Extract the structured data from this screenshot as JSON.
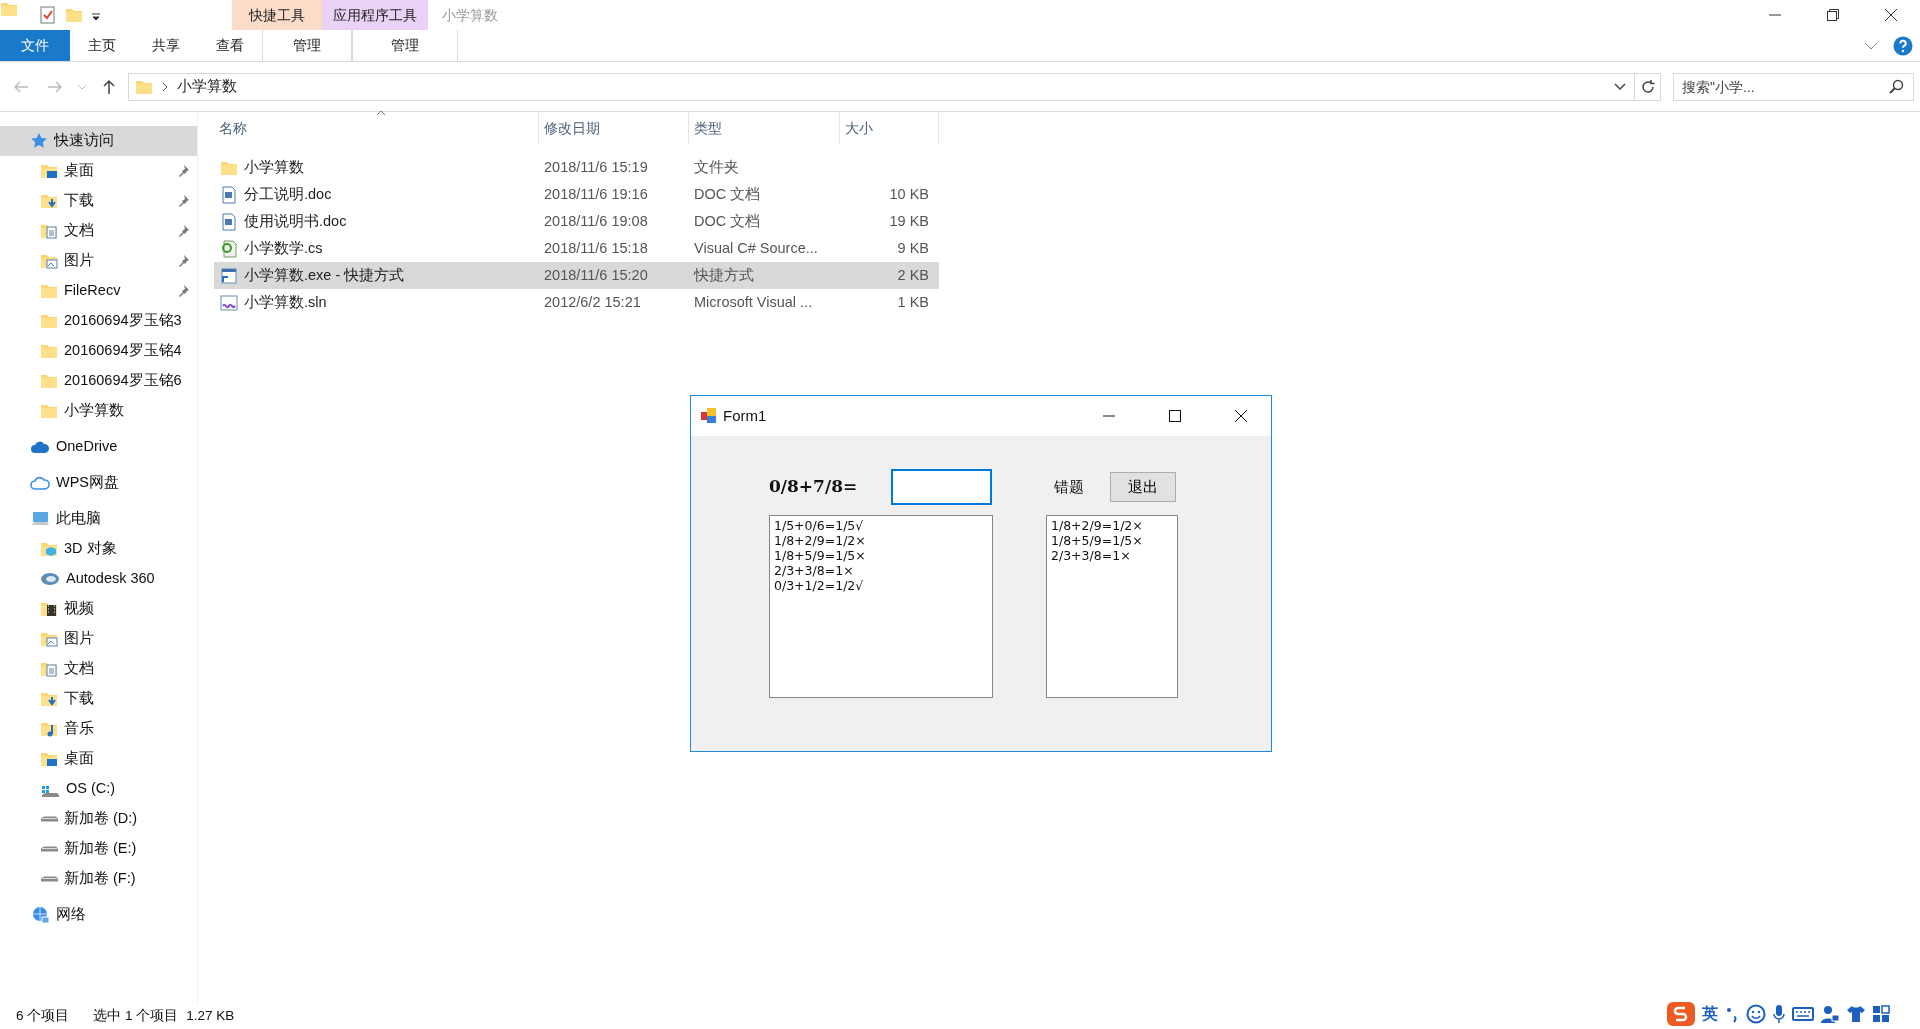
{
  "title_bar": {
    "title": "小学算数",
    "context_groups": [
      {
        "label": "快捷工具",
        "color": "#fcdcc8"
      },
      {
        "label": "应用程序工具",
        "color": "#ead2f6"
      }
    ]
  },
  "ribbon_tabs": [
    {
      "label": "文件",
      "kind": "file"
    },
    {
      "label": "主页",
      "kind": "tab"
    },
    {
      "label": "共享",
      "kind": "tab"
    },
    {
      "label": "查看",
      "kind": "tab"
    },
    {
      "label": "管理",
      "kind": "context"
    },
    {
      "label": "管理",
      "kind": "context"
    }
  ],
  "address_bar": {
    "path": "小学算数",
    "search_placeholder": "搜索\"小学..."
  },
  "sidebar": [
    {
      "label": "快速访问",
      "kind": "star",
      "selected": true,
      "children": [
        {
          "label": "桌面",
          "kind": "desktop",
          "pinned": true,
          "selected": false
        },
        {
          "label": "下载",
          "kind": "download",
          "pinned": true,
          "selected": false
        },
        {
          "label": "文档",
          "kind": "doc",
          "pinned": true,
          "selected": false
        },
        {
          "label": "图片",
          "kind": "pictures",
          "pinned": true,
          "selected": false
        },
        {
          "label": "FileRecv",
          "kind": "folder",
          "pinned": true,
          "selected": false
        },
        {
          "label": "20160694罗玉铭3",
          "kind": "folder",
          "pinned": false,
          "selected": false
        },
        {
          "label": "20160694罗玉铭4",
          "kind": "folder",
          "pinned": false,
          "selected": false
        },
        {
          "label": "20160694罗玉铭6",
          "kind": "folder",
          "pinned": false,
          "selected": false
        },
        {
          "label": "小学算数",
          "kind": "folder",
          "pinned": false,
          "selected": false
        }
      ]
    },
    {
      "label": "OneDrive",
      "kind": "cloud",
      "selected": false
    },
    {
      "label": "WPS网盘",
      "kind": "cloud-outline",
      "selected": false
    },
    {
      "label": "此电脑",
      "kind": "computer",
      "selected": false,
      "children": [
        {
          "label": "3D 对象",
          "kind": "cube",
          "pinned": false,
          "selected": false
        },
        {
          "label": "Autodesk 360",
          "kind": "autodesk",
          "pinned": false,
          "selected": false
        },
        {
          "label": "视频",
          "kind": "video",
          "pinned": false,
          "selected": false
        },
        {
          "label": "图片",
          "kind": "pictures",
          "pinned": false,
          "selected": false
        },
        {
          "label": "文档",
          "kind": "doc",
          "pinned": false,
          "selected": false
        },
        {
          "label": "下载",
          "kind": "download",
          "pinned": false,
          "selected": false
        },
        {
          "label": "音乐",
          "kind": "music",
          "pinned": false,
          "selected": false
        },
        {
          "label": "桌面",
          "kind": "desktop",
          "pinned": false,
          "selected": false
        },
        {
          "label": "OS (C:)",
          "kind": "os-drive",
          "pinned": false,
          "selected": false
        },
        {
          "label": "新加卷 (D:)",
          "kind": "drive",
          "pinned": false,
          "selected": false
        },
        {
          "label": "新加卷 (E:)",
          "kind": "drive",
          "pinned": false,
          "selected": false
        },
        {
          "label": "新加卷 (F:)",
          "kind": "drive",
          "pinned": false,
          "selected": false
        }
      ]
    },
    {
      "label": "网络",
      "kind": "network",
      "selected": false
    }
  ],
  "table": {
    "columns": [
      {
        "label": "名称",
        "sorted": true
      },
      {
        "label": "修改日期",
        "sorted": false
      },
      {
        "label": "类型",
        "sorted": false
      },
      {
        "label": "大小",
        "sorted": false
      }
    ],
    "rows": [
      {
        "kind": "folder",
        "name": "小学算数",
        "date": "2018/11/6 15:19",
        "type": "文件夹",
        "selected": false
      },
      {
        "kind": "word",
        "name": "分工说明.doc",
        "date": "2018/11/6 19:16",
        "type": "DOC 文档",
        "size": "10 KB",
        "selected": false
      },
      {
        "kind": "word",
        "name": "使用说明书.doc",
        "date": "2018/11/6 19:08",
        "type": "DOC 文档",
        "size": "19 KB",
        "selected": false
      },
      {
        "kind": "csharp",
        "name": "小学数学.cs",
        "date": "2018/11/6 15:18",
        "type": "Visual C# Source...",
        "size": "9 KB",
        "selected": false
      },
      {
        "kind": "shortcut",
        "name": "小学算数.exe - 快捷方式",
        "date": "2018/11/6 15:20",
        "type": "快捷方式",
        "size": "2 KB",
        "selected": true
      },
      {
        "kind": "solution",
        "name": "小学算数.sln",
        "date": "2012/6/2 15:21",
        "type": "Microsoft Visual ...",
        "size": "1 KB",
        "selected": false
      }
    ]
  },
  "status_bar": {
    "count": "6 个项目",
    "selection": "选中 1 个项目",
    "size": "1.27 KB"
  },
  "form_window": {
    "title": "Form1",
    "question": "0/8+7/8=",
    "answer": {
      "focused": true
    },
    "wrong_label": "错题",
    "exit_button": "退出",
    "history": [
      "1/5+0/6=1/5√",
      "1/8+2/9=1/2×",
      "1/8+5/9=1/5×",
      "2/3+3/8=1×",
      "0/3+1/2=1/2√"
    ],
    "wrong_list": [
      "1/8+2/9=1/2×",
      "1/8+5/9=1/5×",
      "2/3+3/8=1×"
    ]
  },
  "ime_toolbar": {
    "mode": "英"
  }
}
